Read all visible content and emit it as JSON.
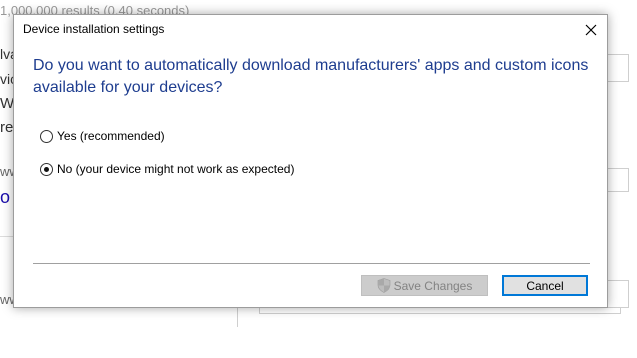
{
  "background": {
    "results": "1,000,000 results (0.40 seconds)",
    "lines": [
      "lva",
      "vic",
      "W",
      "re.",
      "ww",
      "o",
      "ww"
    ]
  },
  "dialog": {
    "title": "Device installation settings",
    "question": "Do you want to automatically download manufacturers' apps and custom icons available for your devices?",
    "options": [
      {
        "label": "Yes (recommended)",
        "selected": false
      },
      {
        "label": "No (your device might not work as expected)",
        "selected": true
      }
    ],
    "save_label": "Save Changes",
    "cancel_label": "Cancel"
  },
  "colors": {
    "heading": "#1e3d8f",
    "focus_border": "#0078d7",
    "disabled_text": "#838383"
  },
  "icons": {
    "close": "close-icon",
    "shield": "uac-shield-icon"
  }
}
